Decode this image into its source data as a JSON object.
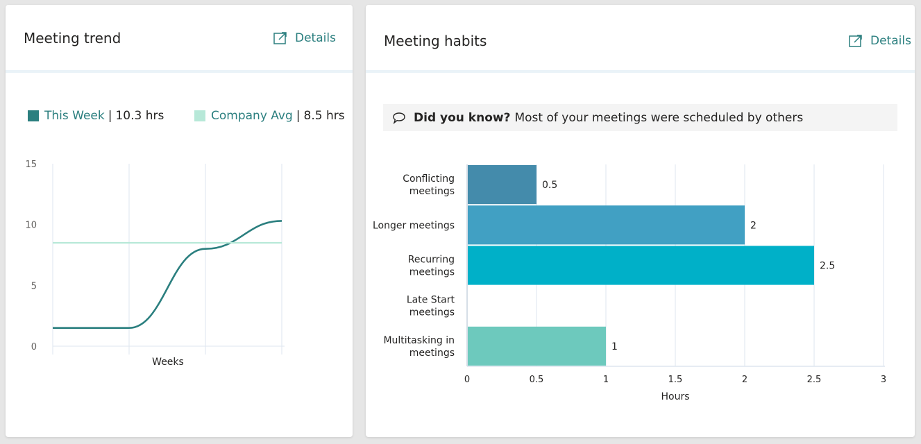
{
  "trend_card": {
    "title": "Meeting trend",
    "details_label": "Details",
    "legend": [
      {
        "series": "This Week",
        "value": "10.3 hrs",
        "color": "#2b7f7f"
      },
      {
        "series": "Company Avg",
        "value": "8.5 hrs",
        "color": "#b7e8d8"
      }
    ],
    "chart_data": {
      "type": "line",
      "xlabel": "Weeks",
      "ylabel": "",
      "ylim": [
        0,
        15
      ],
      "y_ticks": [
        "0",
        "5",
        "10",
        "15"
      ],
      "x": [
        0,
        1,
        2,
        3
      ],
      "series": [
        {
          "name": "This Week",
          "values": [
            1.5,
            1.5,
            8.0,
            10.3
          ],
          "color": "#2b7f7f"
        },
        {
          "name": "Company Avg",
          "values": [
            8.5,
            8.5,
            8.5,
            8.5
          ],
          "color": "#b7e8d8"
        }
      ],
      "grid": true
    }
  },
  "habits_card": {
    "title": "Meeting habits",
    "details_label": "Details",
    "tip": {
      "bold": "Did you know?",
      "text": "Most of your meetings were scheduled by others"
    },
    "chart_data": {
      "type": "bar",
      "orientation": "horizontal",
      "categories": [
        "Conflicting meetings",
        "Longer meetings",
        "Recurring meetings",
        "Late Start meetings",
        "Multitasking in meetings"
      ],
      "values": [
        0.5,
        2,
        2.5,
        0,
        1
      ],
      "data_labels": [
        "0.5",
        "2",
        "2.5",
        "",
        "1"
      ],
      "colors": [
        "#448bab",
        "#41a0c3",
        "#00b0c8",
        "#00b0c8",
        "#6dc9bd"
      ],
      "xlabel": "Hours",
      "xlim": [
        0,
        3
      ],
      "x_ticks": [
        "0",
        "0.5",
        "1",
        "1.5",
        "2",
        "2.5",
        "3"
      ],
      "grid": true
    }
  }
}
